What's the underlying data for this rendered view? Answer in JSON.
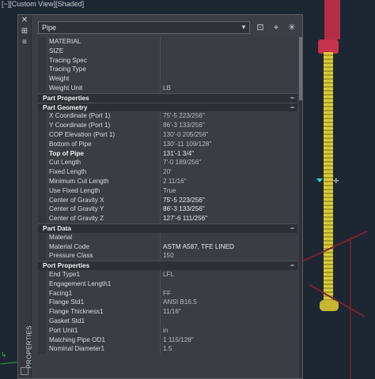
{
  "viewport": {
    "label": "[−][Custom View][Shaded]"
  },
  "palette": {
    "side_title": "PROPERTIES",
    "close_glyph": "✕",
    "pin_glyph": "⊞",
    "menu_glyph": "≡",
    "object_selector": "Pipe",
    "icons": [
      "select-objects-icon",
      "pick-add-icon",
      "quick-select-icon"
    ]
  },
  "rows_top": [
    {
      "label": "MATERIAL",
      "value": ""
    },
    {
      "label": "SIZE",
      "value": ""
    },
    {
      "label": "Tracing Spec",
      "value": ""
    },
    {
      "label": "Tracing Type",
      "value": ""
    },
    {
      "label": "Weight",
      "value": ""
    },
    {
      "label": "Weight Unit",
      "value": "LB"
    }
  ],
  "categories": {
    "part_properties": "Part Properties",
    "part_geometry": "Part Geometry",
    "part_data": "Part Data",
    "port_properties": "Port Properties",
    "toggle": "−"
  },
  "geometry_rows": [
    {
      "label": "X Coordinate (Port 1)",
      "value": "75'-5 223/256\""
    },
    {
      "label": "Y Coordinate (Port 1)",
      "value": "86'-3 133/256\""
    },
    {
      "label": "COP Elevation (Port 1)",
      "value": "130'-0 205/256\""
    },
    {
      "label": "Bottom of Pipe",
      "value": "130'-11 109/128\""
    },
    {
      "label": "Top of Pipe",
      "value": "131'-1 3/4\""
    },
    {
      "label": "Cut Length",
      "value": "7'-0 189/256\""
    },
    {
      "label": "Fixed Length",
      "value": "20'"
    },
    {
      "label": "Minimum Cut Length",
      "value": "2 11/16\""
    },
    {
      "label": "Use Fixed Length",
      "value": "True"
    },
    {
      "label": "Center of Gravity X",
      "value": "75'-5 223/256\""
    },
    {
      "label": "Center of Gravity Y",
      "value": "86'-3 133/256\""
    },
    {
      "label": "Center of Gravity Z",
      "value": "127'-6 111/256\""
    }
  ],
  "data_rows": [
    {
      "label": "Material",
      "value": ""
    },
    {
      "label": "Material Code",
      "value": "ASTM A587, TFE LINED"
    },
    {
      "label": "Pressure Class",
      "value": "150"
    }
  ],
  "port_rows": [
    {
      "label": "End Type1",
      "value": "LFL"
    },
    {
      "label": "Engagement Length1",
      "value": ""
    },
    {
      "label": "Facing1",
      "value": "FF"
    },
    {
      "label": "Flange Std1",
      "value": "ANSI B16.5"
    },
    {
      "label": "Flange Thickness1",
      "value": "11/16\""
    },
    {
      "label": "Gasket Std1",
      "value": ""
    },
    {
      "label": "Port Unit1",
      "value": "in"
    },
    {
      "label": "Matching Pipe OD1",
      "value": "1 115/128\""
    },
    {
      "label": "Nominal Diameter1",
      "value": "1.5"
    }
  ],
  "colors": {
    "palette_bg": "#3b3f44",
    "category_bg": "#2c3035",
    "viewport_bg": "#1d2633",
    "pipe_yellow": "#d9cc3a",
    "pipe_red": "#c6334a"
  }
}
